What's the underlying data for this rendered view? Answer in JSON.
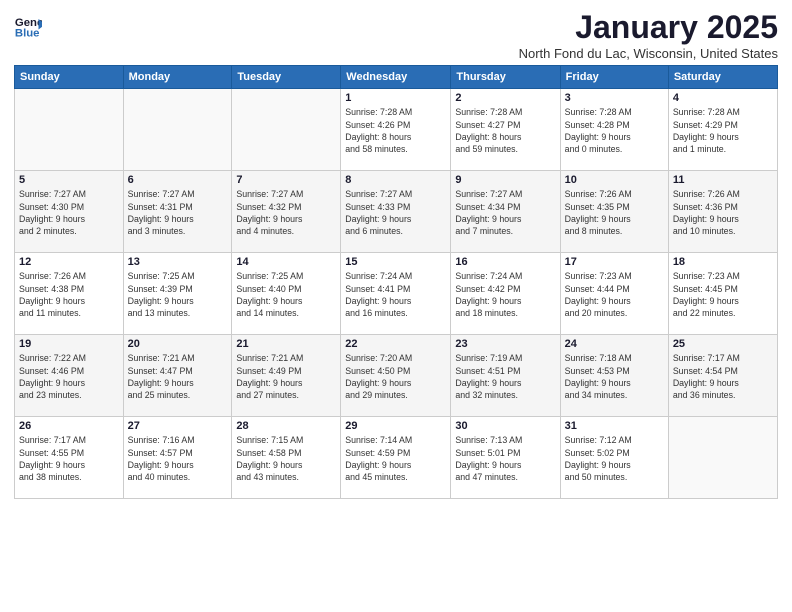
{
  "logo": {
    "line1": "General",
    "line2": "Blue"
  },
  "title": "January 2025",
  "location": "North Fond du Lac, Wisconsin, United States",
  "days_header": [
    "Sunday",
    "Monday",
    "Tuesday",
    "Wednesday",
    "Thursday",
    "Friday",
    "Saturday"
  ],
  "weeks": [
    [
      {
        "num": "",
        "info": ""
      },
      {
        "num": "",
        "info": ""
      },
      {
        "num": "",
        "info": ""
      },
      {
        "num": "1",
        "info": "Sunrise: 7:28 AM\nSunset: 4:26 PM\nDaylight: 8 hours\nand 58 minutes."
      },
      {
        "num": "2",
        "info": "Sunrise: 7:28 AM\nSunset: 4:27 PM\nDaylight: 8 hours\nand 59 minutes."
      },
      {
        "num": "3",
        "info": "Sunrise: 7:28 AM\nSunset: 4:28 PM\nDaylight: 9 hours\nand 0 minutes."
      },
      {
        "num": "4",
        "info": "Sunrise: 7:28 AM\nSunset: 4:29 PM\nDaylight: 9 hours\nand 1 minute."
      }
    ],
    [
      {
        "num": "5",
        "info": "Sunrise: 7:27 AM\nSunset: 4:30 PM\nDaylight: 9 hours\nand 2 minutes."
      },
      {
        "num": "6",
        "info": "Sunrise: 7:27 AM\nSunset: 4:31 PM\nDaylight: 9 hours\nand 3 minutes."
      },
      {
        "num": "7",
        "info": "Sunrise: 7:27 AM\nSunset: 4:32 PM\nDaylight: 9 hours\nand 4 minutes."
      },
      {
        "num": "8",
        "info": "Sunrise: 7:27 AM\nSunset: 4:33 PM\nDaylight: 9 hours\nand 6 minutes."
      },
      {
        "num": "9",
        "info": "Sunrise: 7:27 AM\nSunset: 4:34 PM\nDaylight: 9 hours\nand 7 minutes."
      },
      {
        "num": "10",
        "info": "Sunrise: 7:26 AM\nSunset: 4:35 PM\nDaylight: 9 hours\nand 8 minutes."
      },
      {
        "num": "11",
        "info": "Sunrise: 7:26 AM\nSunset: 4:36 PM\nDaylight: 9 hours\nand 10 minutes."
      }
    ],
    [
      {
        "num": "12",
        "info": "Sunrise: 7:26 AM\nSunset: 4:38 PM\nDaylight: 9 hours\nand 11 minutes."
      },
      {
        "num": "13",
        "info": "Sunrise: 7:25 AM\nSunset: 4:39 PM\nDaylight: 9 hours\nand 13 minutes."
      },
      {
        "num": "14",
        "info": "Sunrise: 7:25 AM\nSunset: 4:40 PM\nDaylight: 9 hours\nand 14 minutes."
      },
      {
        "num": "15",
        "info": "Sunrise: 7:24 AM\nSunset: 4:41 PM\nDaylight: 9 hours\nand 16 minutes."
      },
      {
        "num": "16",
        "info": "Sunrise: 7:24 AM\nSunset: 4:42 PM\nDaylight: 9 hours\nand 18 minutes."
      },
      {
        "num": "17",
        "info": "Sunrise: 7:23 AM\nSunset: 4:44 PM\nDaylight: 9 hours\nand 20 minutes."
      },
      {
        "num": "18",
        "info": "Sunrise: 7:23 AM\nSunset: 4:45 PM\nDaylight: 9 hours\nand 22 minutes."
      }
    ],
    [
      {
        "num": "19",
        "info": "Sunrise: 7:22 AM\nSunset: 4:46 PM\nDaylight: 9 hours\nand 23 minutes."
      },
      {
        "num": "20",
        "info": "Sunrise: 7:21 AM\nSunset: 4:47 PM\nDaylight: 9 hours\nand 25 minutes."
      },
      {
        "num": "21",
        "info": "Sunrise: 7:21 AM\nSunset: 4:49 PM\nDaylight: 9 hours\nand 27 minutes."
      },
      {
        "num": "22",
        "info": "Sunrise: 7:20 AM\nSunset: 4:50 PM\nDaylight: 9 hours\nand 29 minutes."
      },
      {
        "num": "23",
        "info": "Sunrise: 7:19 AM\nSunset: 4:51 PM\nDaylight: 9 hours\nand 32 minutes."
      },
      {
        "num": "24",
        "info": "Sunrise: 7:18 AM\nSunset: 4:53 PM\nDaylight: 9 hours\nand 34 minutes."
      },
      {
        "num": "25",
        "info": "Sunrise: 7:17 AM\nSunset: 4:54 PM\nDaylight: 9 hours\nand 36 minutes."
      }
    ],
    [
      {
        "num": "26",
        "info": "Sunrise: 7:17 AM\nSunset: 4:55 PM\nDaylight: 9 hours\nand 38 minutes."
      },
      {
        "num": "27",
        "info": "Sunrise: 7:16 AM\nSunset: 4:57 PM\nDaylight: 9 hours\nand 40 minutes."
      },
      {
        "num": "28",
        "info": "Sunrise: 7:15 AM\nSunset: 4:58 PM\nDaylight: 9 hours\nand 43 minutes."
      },
      {
        "num": "29",
        "info": "Sunrise: 7:14 AM\nSunset: 4:59 PM\nDaylight: 9 hours\nand 45 minutes."
      },
      {
        "num": "30",
        "info": "Sunrise: 7:13 AM\nSunset: 5:01 PM\nDaylight: 9 hours\nand 47 minutes."
      },
      {
        "num": "31",
        "info": "Sunrise: 7:12 AM\nSunset: 5:02 PM\nDaylight: 9 hours\nand 50 minutes."
      },
      {
        "num": "",
        "info": ""
      }
    ]
  ]
}
